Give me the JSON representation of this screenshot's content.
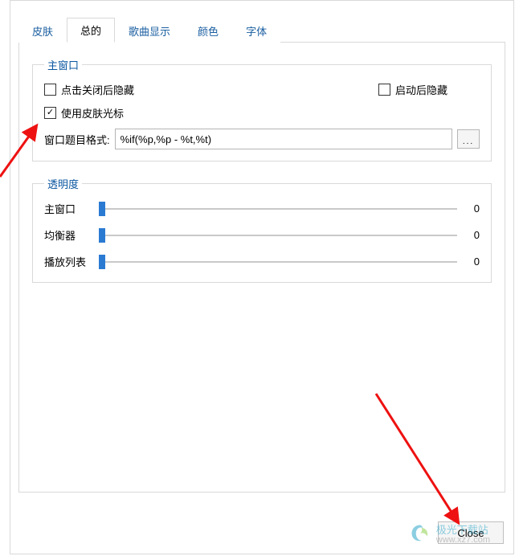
{
  "tabs": {
    "items": [
      "皮肤",
      "总的",
      "歌曲显示",
      "颜色",
      "字体"
    ],
    "active_index": 1
  },
  "group_main": {
    "legend": "主窗口",
    "chk_close_hide": {
      "label": "点击关闭后隐藏",
      "checked": false
    },
    "chk_start_hidden": {
      "label": "启动后隐藏",
      "checked": false
    },
    "chk_use_skin_cursor": {
      "label": "使用皮肤光标",
      "checked": true
    },
    "title_format_label": "窗口题目格式:",
    "title_format_value": "%if(%p,%p - %t,%t)",
    "more_btn": "..."
  },
  "group_opacity": {
    "legend": "透明度",
    "rows": [
      {
        "label": "主窗口",
        "value": 0
      },
      {
        "label": "均衡器",
        "value": 0
      },
      {
        "label": "播放列表",
        "value": 0
      }
    ]
  },
  "close_button": "Close",
  "watermark": {
    "text": "极光下载站",
    "domain": "www.xz7.com"
  }
}
